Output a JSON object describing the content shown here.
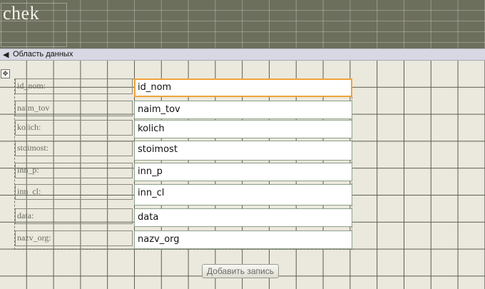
{
  "form_header": {
    "title": "chek"
  },
  "section": {
    "label": "Область данных"
  },
  "fields": [
    {
      "label": "id_nom:",
      "value": "id_nom"
    },
    {
      "label": "naim_tov",
      "value": "naim_tov"
    },
    {
      "label": "kolich:",
      "value": "kolich"
    },
    {
      "label": "stoimost:",
      "value": "stoimost"
    },
    {
      "label": "inn_p:",
      "value": "inn_p"
    },
    {
      "label": "inn_cl:",
      "value": "inn_cl"
    },
    {
      "label": "data:",
      "value": "data"
    },
    {
      "label": "nazv_org:",
      "value": "nazv_org"
    }
  ],
  "add_button": {
    "label": "Добавить запись"
  },
  "colors": {
    "header_bg": "#6d6f5d",
    "section_bg": "#d7d8e3",
    "detail_bg": "#ebe9dd",
    "selection": "#f2a23a"
  }
}
